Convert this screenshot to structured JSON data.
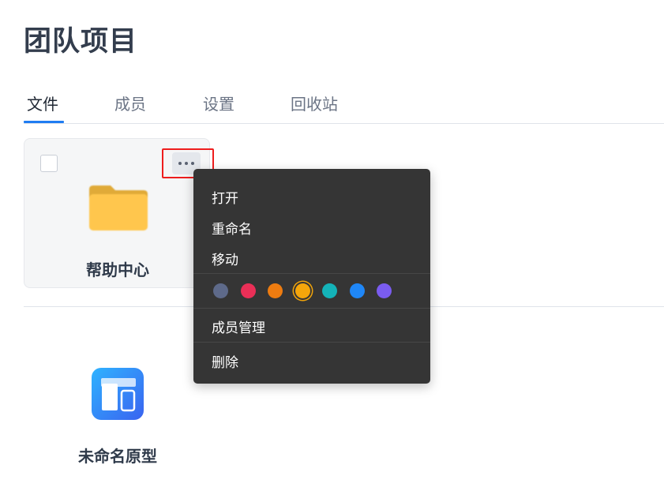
{
  "page": {
    "title": "团队项目"
  },
  "tabs": [
    {
      "label": "文件",
      "active": true
    },
    {
      "label": "成员",
      "active": false
    },
    {
      "label": "设置",
      "active": false
    },
    {
      "label": "回收站",
      "active": false
    }
  ],
  "folder": {
    "name": "帮助中心",
    "icon": "folder-icon",
    "color": "#ffc64d"
  },
  "prototype": {
    "name": "未命名原型",
    "icon": "prototype-icon"
  },
  "context_menu": {
    "items": [
      "打开",
      "重命名",
      "移动",
      "成员管理",
      "删除"
    ],
    "colors": [
      "#5e6a8a",
      "#ea2f57",
      "#ee7c10",
      "#f5a60b",
      "#14b3b8",
      "#1f87f7",
      "#7a5cf0"
    ],
    "selected_color": "#f5a60b"
  },
  "colors": {
    "accent": "#1f7cf2",
    "highlight": "#ee1d1d",
    "menu_bg": "#353535"
  }
}
